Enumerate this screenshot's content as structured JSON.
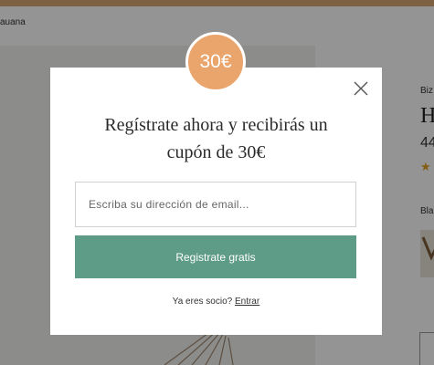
{
  "page": {
    "breadcrumb": "auana",
    "side_brand": "Biz",
    "side_title": "H",
    "side_price": "44",
    "side_star": "★",
    "side_color_label": "Bla"
  },
  "modal": {
    "badge": "30€",
    "headline_line1": "Regístrate ahora y recibirás un",
    "headline_line2": "cupón de 30€",
    "email_placeholder": "Escriba su dirección de email...",
    "submit_label": "Registrate gratis",
    "login_prompt": "Ya eres socio?",
    "login_link": "Entrar"
  },
  "colors": {
    "accent_orange": "#e9a56c",
    "button_green": "#5f9c88",
    "top_bar": "#d9a574",
    "star": "#e0a020"
  },
  "icons": {
    "close": "close-icon",
    "rating": "star-icon"
  }
}
